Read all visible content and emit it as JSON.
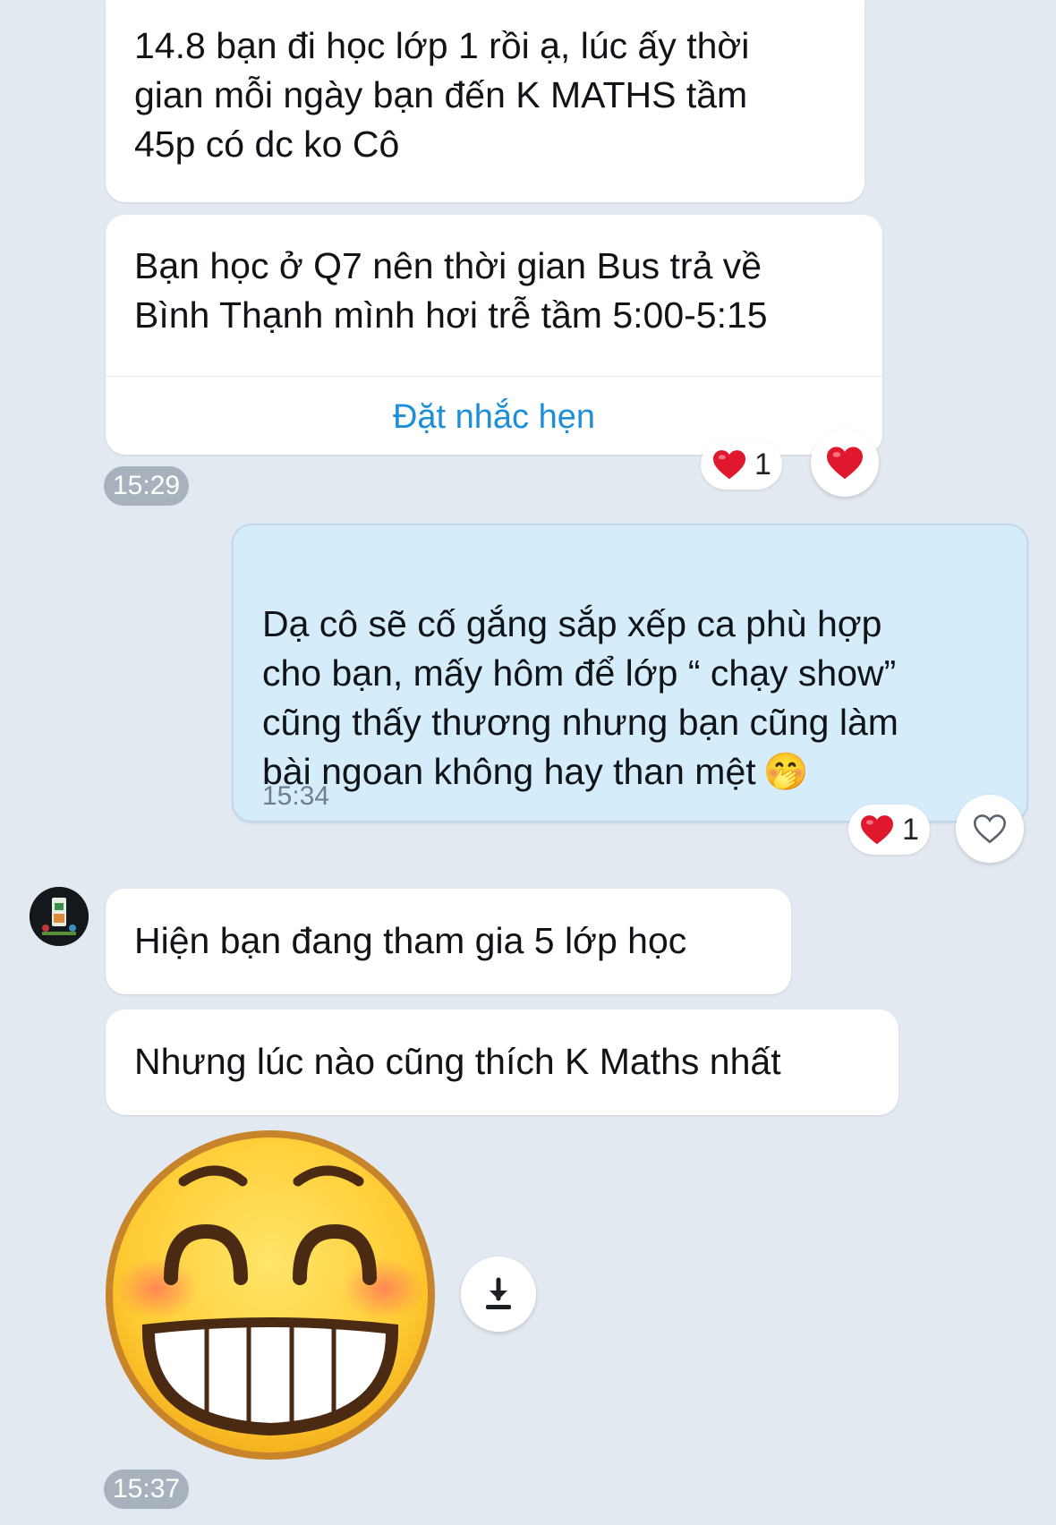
{
  "messages": [
    {
      "text": "14.8 bạn đi học lớp 1 rồi ạ, lúc ấy thời\ngian mỗi ngày bạn đến K MATHS tầm\n45p có dc ko Cô"
    },
    {
      "text": "Bạn học ở Q7 nên thời gian Bus trả về\nBình Thạnh mình hơi trễ tầm 5:00-5:15",
      "action": "Đặt nhắc hẹn",
      "time": "15:29",
      "reaction_count": "1",
      "reaction_icon": "heart-filled-icon"
    },
    {
      "text": "Dạ cô sẽ cố gắng sắp xếp ca phù hợp\ncho bạn, mấy hôm để lớp “ chạy show”\ncũng thấy thương nhưng bạn cũng làm\nbài ngoan không hay than mệt",
      "emoji": "🤭",
      "time": "15:34",
      "reaction_count": "1",
      "reaction_icon": "heart-outline-icon"
    },
    {
      "text": "Hiện bạn đang tham gia 5 lớp học"
    },
    {
      "text": "Nhưng lúc nào cũng thích K Maths nhất"
    },
    {
      "sticker": "grinning-face-sticker",
      "time": "15:37"
    }
  ],
  "colors": {
    "background": "#e2e9f1",
    "incoming_bubble": "#ffffff",
    "outgoing_bubble": "#d5ecfb",
    "link": "#1f8ed8",
    "heart": "#e0182d"
  }
}
